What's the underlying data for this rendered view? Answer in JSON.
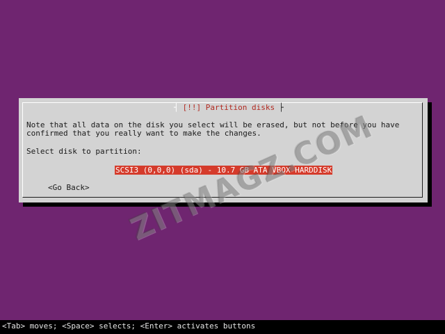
{
  "dialog": {
    "title_marker_left": "┤",
    "title": "[!!] Partition disks",
    "title_marker_right": "├",
    "message_line1": "Note that all data on the disk you select will be erased, but not before you have",
    "message_line2": "confirmed that you really want to make the changes.",
    "prompt": "Select disk to partition:",
    "disk_option": "SCSI3 (0,0,0) (sda) - 10.7 GB ATA VBOX HARDDISK",
    "go_back_label": "<Go Back>"
  },
  "footer": {
    "help_text": "<Tab> moves; <Space> selects; <Enter> activates buttons"
  },
  "watermark": {
    "text": "ZITMAGZ.COM"
  },
  "colors": {
    "background": "#6f2570",
    "dialog": "#d3d3d3",
    "title": "#b12a21",
    "selection": "#d53b2b",
    "footer": "#000000"
  }
}
